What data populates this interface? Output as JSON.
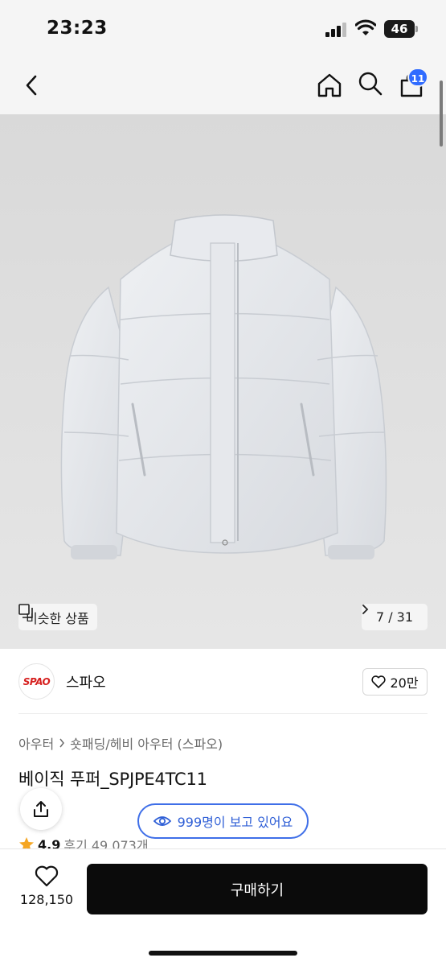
{
  "status_bar": {
    "time": "23:23",
    "battery": "46"
  },
  "nav": {
    "cart_badge": "11"
  },
  "hero": {
    "similar_label": "비슷한 상품",
    "page_indicator": "7 / 31"
  },
  "brand": {
    "logo_text": "SPAO",
    "name": "스파오",
    "likes": "20만"
  },
  "product": {
    "breadcrumb": [
      "아우터",
      "숏패딩/헤비 아우터 (스파오)"
    ],
    "title": "베이직 푸퍼_SPJPE4TC11",
    "viewers": "999명이 보고 있어요",
    "rating": "4.9",
    "reviews": "후기 49,073개"
  },
  "bottom": {
    "wish_count": "128,150",
    "buy_label": "구매하기"
  },
  "colors": {
    "accent": "#2f6bff",
    "viewers_border": "#3f6fe8",
    "buy_bg": "#0b0b0b",
    "star": "#f5a623"
  }
}
